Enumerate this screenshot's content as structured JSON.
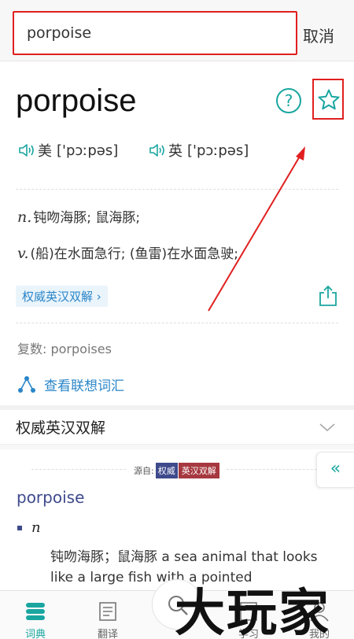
{
  "search": {
    "value": "porpoise",
    "cancel_label": "取消"
  },
  "word": {
    "title": "porpoise",
    "help_glyph": "?",
    "pron_us_label": "美",
    "pron_us_ipa": "['pɔːpəs]",
    "pron_uk_label": "英",
    "pron_uk_ipa": "['pɔːpəs]"
  },
  "definitions": [
    {
      "pos": "n.",
      "text": "钝吻海豚; 鼠海豚;"
    },
    {
      "pos": "v.",
      "text": "(船)在水面急行; (鱼雷)在水面急驶;"
    }
  ],
  "authority_tag": "权威英汉双解 ›",
  "plural": "复数: porpoises",
  "related_label": "查看联想词汇",
  "section": {
    "title": "权威英汉双解"
  },
  "source": {
    "prefix": "源自:",
    "part1": "权威",
    "part2": "英汉双解"
  },
  "collapse_glyph": "«",
  "entry": {
    "word": "porpoise",
    "pos": "n",
    "definition": "钝吻海豚；鼠海豚 a sea animal that looks like a large fish with a pointed"
  },
  "nav": {
    "dict": "词典",
    "translate": "翻译",
    "study": "学习",
    "mine": "我的"
  },
  "watermark": "大玩家",
  "colors": {
    "accent": "#1aa6a0",
    "link": "#2a86c8",
    "annotation": "#e02020"
  }
}
